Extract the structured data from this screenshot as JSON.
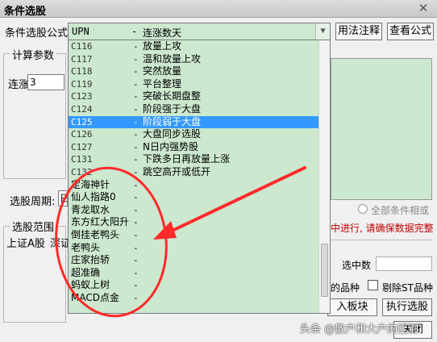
{
  "window": {
    "title": "条件选股",
    "close_glyph": "✕"
  },
  "formula": {
    "label": "条件选股公式",
    "selected_code": "UPN",
    "selected_dash": "-",
    "selected_name": "连涨数天",
    "arrow_glyph": "▼"
  },
  "buttons": {
    "usage": "用法注释",
    "view": "查看公式",
    "import": "入板块",
    "execute": "执行选股",
    "close": "关闭"
  },
  "calc_params": {
    "label": "计算参数",
    "lianzhang_label": "连涨",
    "lianzhang_value": "3"
  },
  "period": {
    "label": "选股周期:",
    "value": "日"
  },
  "range": {
    "label": "选股范围",
    "value": "上证A股",
    "extra": "深证"
  },
  "right": {
    "all_conditions_label": "全部条件相或",
    "warning": "中进行, 请确保数据完整",
    "selected_count_label": "选中数",
    "variety_label": "的品种",
    "st_label": "剔除ST品种"
  },
  "dropdown_items": [
    {
      "code": "C116",
      "dash": "-",
      "name": "放量上攻"
    },
    {
      "code": "C117",
      "dash": "-",
      "name": "温和放量上攻"
    },
    {
      "code": "C118",
      "dash": "-",
      "name": "突然放量"
    },
    {
      "code": "C119",
      "dash": "-",
      "name": "平台整理"
    },
    {
      "code": "C123",
      "dash": "-",
      "name": "突破长期盘整"
    },
    {
      "code": "C124",
      "dash": "-",
      "name": "阶段强于大盘"
    },
    {
      "code": "C125",
      "dash": "-",
      "name": "阶段弱于大盘"
    },
    {
      "code": "C126",
      "dash": "-",
      "name": "大盘同步选股"
    },
    {
      "code": "C127",
      "dash": "-",
      "name": "N日内强势股"
    },
    {
      "code": "C131",
      "dash": "-",
      "name": "下跌多日再放量上涨"
    },
    {
      "code": "C132",
      "dash": "-",
      "name": "跳空高开或低开"
    },
    {
      "code": "",
      "dash": "-",
      "name": "定海神针"
    },
    {
      "code": "",
      "dash": "-",
      "name": "仙人指路0"
    },
    {
      "code": "",
      "dash": "-",
      "name": "青龙取水"
    },
    {
      "code": "",
      "dash": "-",
      "name": "东方红大阳升"
    },
    {
      "code": "",
      "dash": "-",
      "name": "倒挂老鸭头"
    },
    {
      "code": "",
      "dash": "-",
      "name": "老鸭头"
    },
    {
      "code": "",
      "dash": "-",
      "name": "庄家抬轿"
    },
    {
      "code": "",
      "dash": "-",
      "name": "超准确"
    },
    {
      "code": "",
      "dash": "-",
      "name": "蚂蚁上树"
    },
    {
      "code": "",
      "dash": "-",
      "name": "MACD点金"
    }
  ],
  "selected_index": 6,
  "watermark": "头条 @散户和大户的区别",
  "colors": {
    "list_bg": "#cce8cf",
    "selection": "#3399ff",
    "annotation": "#ff2a2a",
    "warning": "#c00000"
  }
}
